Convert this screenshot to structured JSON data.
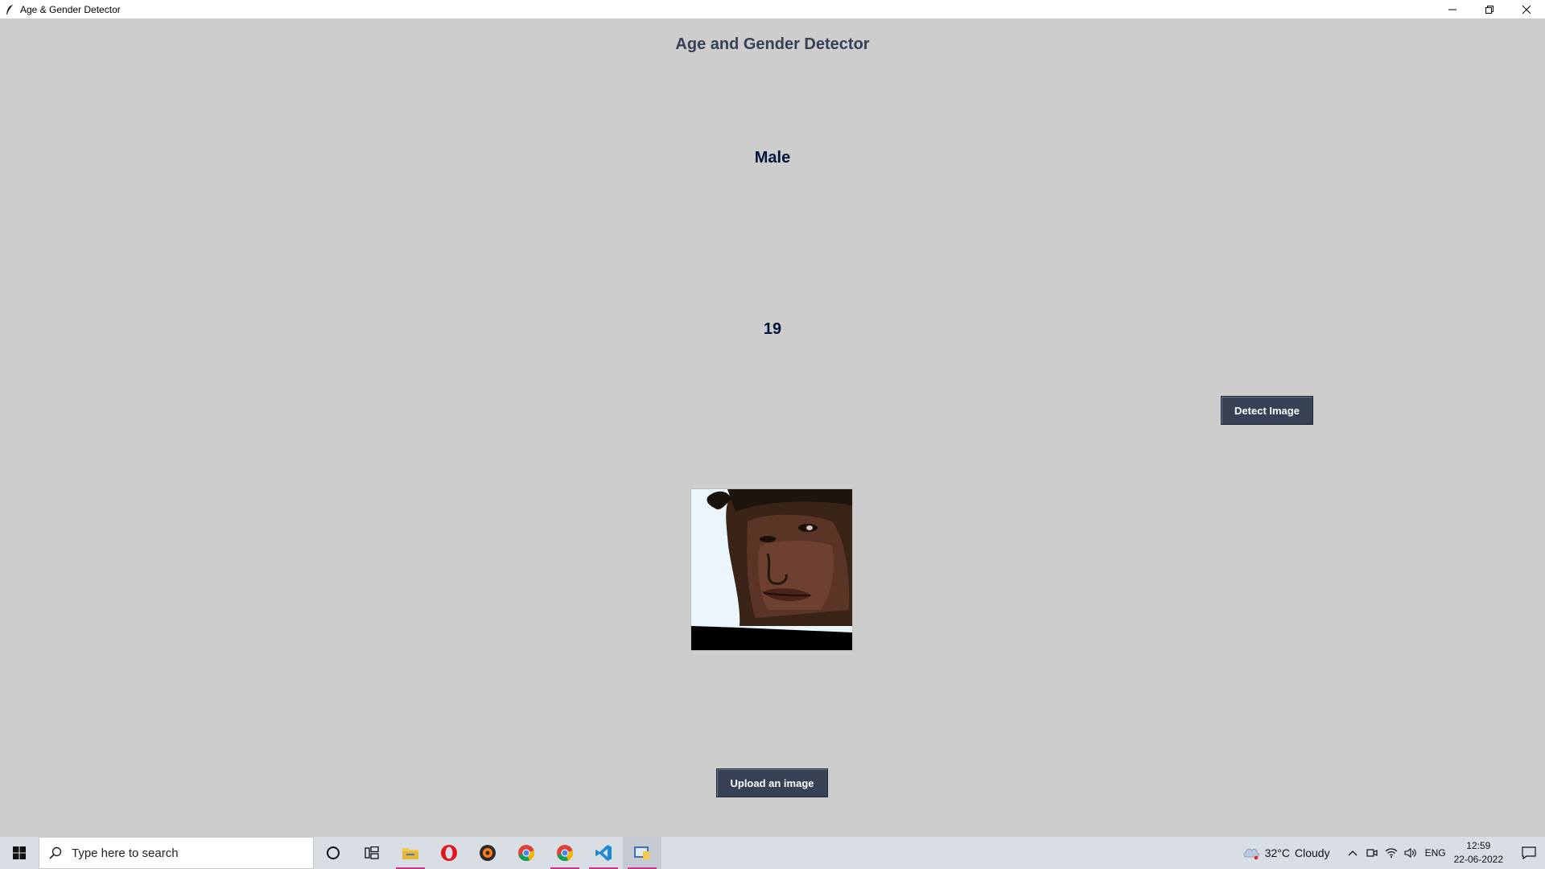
{
  "window": {
    "title": "Age & Gender Detector",
    "controls": {
      "minimize": "–",
      "restore": "❐",
      "close": "✕"
    }
  },
  "app": {
    "heading": "Age and Gender Detector",
    "gender_result": "Male",
    "age_result": "19",
    "detect_button_label": "Detect Image",
    "upload_button_label": "Upload an image",
    "colors": {
      "background": "#cdcdcd",
      "heading": "#364156",
      "result_text": "#011638",
      "button_bg": "#364156",
      "button_text": "#ffffff"
    }
  },
  "taskbar": {
    "search_placeholder": "Type here to search",
    "pinned_icons": [
      "cortana-icon",
      "task-view-icon",
      "file-explorer-icon",
      "opera-icon",
      "media-player-icon",
      "chrome-icon",
      "chrome-profile-icon",
      "vscode-icon",
      "python-app-icon"
    ],
    "weather": {
      "temperature": "32°C",
      "condition": "Cloudy"
    },
    "language": "ENG",
    "time": "12:59",
    "date": "22-06-2022"
  }
}
